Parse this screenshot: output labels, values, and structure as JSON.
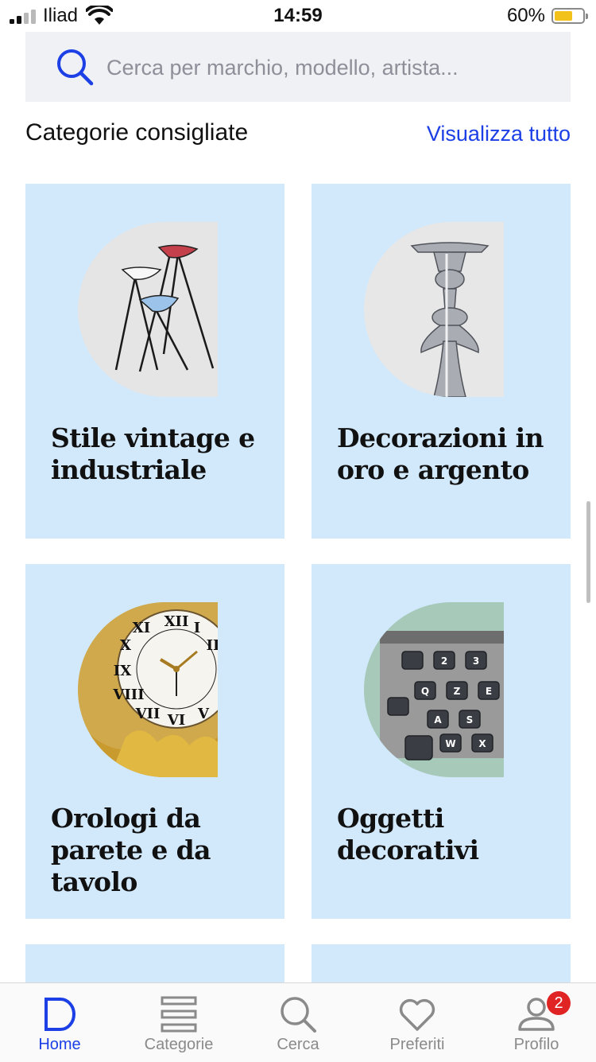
{
  "status_bar": {
    "carrier": "Iliad",
    "time": "14:59",
    "battery": "60%"
  },
  "search": {
    "placeholder": "Cerca per marchio, modello, artista..."
  },
  "section": {
    "title": "Categorie consigliate",
    "view_all": "Visualizza tutto"
  },
  "categories": [
    {
      "title": "Stile vintage e industriale"
    },
    {
      "title": "Decorazioni in oro e argento"
    },
    {
      "title": "Orologi da parete e da tavolo"
    },
    {
      "title": "Oggetti decorativi"
    }
  ],
  "tabs": [
    {
      "label": "Home",
      "icon": "home-icon",
      "active": true
    },
    {
      "label": "Categorie",
      "icon": "categories-icon"
    },
    {
      "label": "Cerca",
      "icon": "search-icon"
    },
    {
      "label": "Preferiti",
      "icon": "heart-icon"
    },
    {
      "label": "Profilo",
      "icon": "profile-icon",
      "badge": "2"
    }
  ],
  "colors": {
    "accent": "#1c40e6",
    "card_bg": "#d2e9fc",
    "search_bg": "#eff1f5",
    "badge": "#e02424"
  }
}
